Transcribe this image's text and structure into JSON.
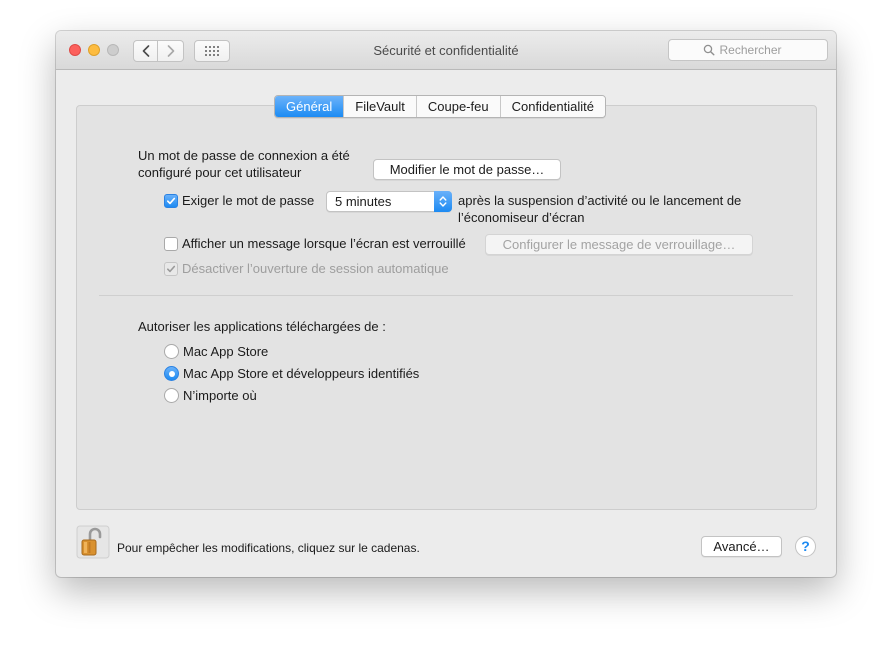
{
  "window": {
    "title": "Sécurité et confidentialité"
  },
  "search": {
    "placeholder": "Rechercher"
  },
  "icons": {
    "back": "chevron-left-icon",
    "forward": "chevron-right-icon",
    "show_all": "grid-icon",
    "search": "magnifier-icon",
    "lock": "open-padlock-icon",
    "help": "question-mark-icon"
  },
  "tabs": [
    {
      "label": "Général",
      "active": true
    },
    {
      "label": "FileVault",
      "active": false
    },
    {
      "label": "Coupe-feu",
      "active": false
    },
    {
      "label": "Confidentialité",
      "active": false
    }
  ],
  "general": {
    "password_line1": "Un mot de passe de connexion a été",
    "password_line2": "configuré pour cet utilisateur",
    "change_password_button": "Modifier le mot de passe…",
    "require_password_label": "Exiger le mot de passe",
    "require_password_checked": true,
    "require_password_delay": "5 minutes",
    "after_sleep_line1": "après la suspension d’activité ou le lancement de",
    "after_sleep_line2": "l’économiseur d’écran",
    "show_message_label": "Afficher un message lorsque l’écran est verrouillé",
    "show_message_checked": false,
    "set_lock_message_button": "Configurer le message de verrouillage…",
    "disable_autologin_label": "Désactiver l’ouverture de session automatique",
    "disable_autologin_checked": true,
    "allow_apps_label": "Autoriser les applications téléchargées de :",
    "app_sources": [
      {
        "label": "Mac App Store",
        "selected": false
      },
      {
        "label": "Mac App Store et développeurs identifiés",
        "selected": true
      },
      {
        "label": "N’importe où",
        "selected": false
      }
    ]
  },
  "footer": {
    "lock_text": "Pour empêcher les modifications, cliquez sur le cadenas.",
    "advanced_button": "Avancé…",
    "help_label": "?"
  },
  "colors": {
    "accent": "#1d8af2",
    "window_bg": "#ececec",
    "panel_bg": "#e3e3e3",
    "close": "#fc605c",
    "minimize": "#fdbc40",
    "lock_gold": "#d9912f"
  }
}
